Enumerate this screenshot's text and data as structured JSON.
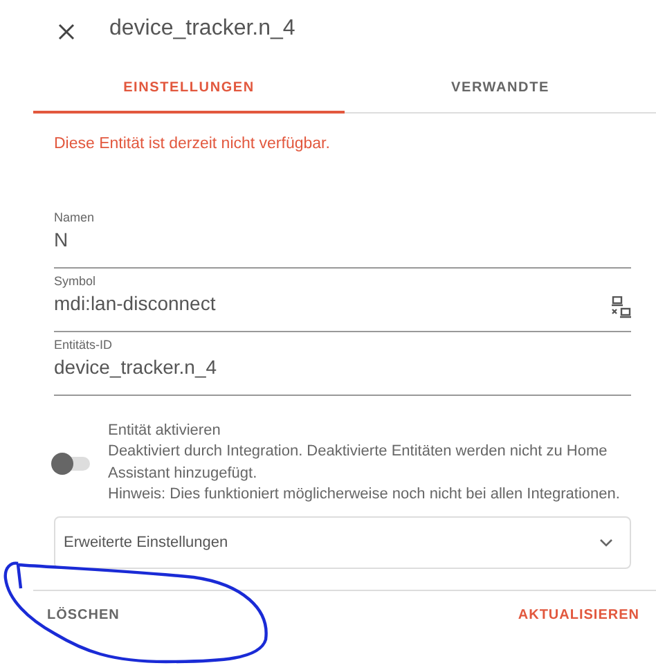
{
  "dialog": {
    "title": "device_tracker.n_4"
  },
  "tabs": [
    {
      "label": "EINSTELLUNGEN",
      "selected": true
    },
    {
      "label": "VERWANDTE",
      "selected": false
    }
  ],
  "warning": "Diese Entität ist derzeit nicht verfügbar.",
  "fields": [
    {
      "label": "Namen",
      "value": "N",
      "kind": "text"
    },
    {
      "label": "Symbol",
      "value": "mdi:lan-disconnect",
      "kind": "icon"
    },
    {
      "label": "Entitäts-ID",
      "value": "device_tracker.n_4",
      "kind": "text"
    }
  ],
  "enable": {
    "on": false,
    "title": "Entität aktivieren",
    "lines": [
      "Deaktiviert durch Integration. Deaktivierte Entitäten werden nicht zu Home Assistant hinzugefügt.",
      "Hinweis: Dies funktioniert möglicherweise noch nicht bei allen Integrationen."
    ]
  },
  "advanced": {
    "label": "Erweiterte Einstellungen",
    "expanded": false
  },
  "buttons": [
    {
      "label": "LÖSCHEN",
      "kind": "plain"
    },
    {
      "label": "AKTUALISIEREN",
      "kind": "primary"
    }
  ],
  "annotation": {
    "kind": "circle"
  }
}
